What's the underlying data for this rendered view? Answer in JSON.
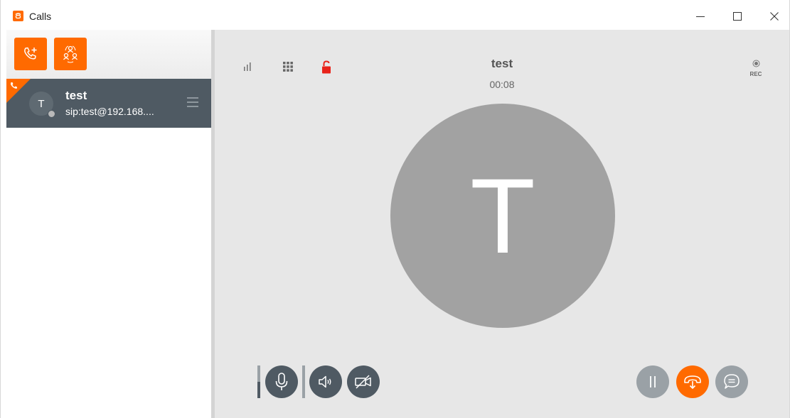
{
  "window": {
    "title": "Calls",
    "minimize_icon": "minimize-icon",
    "maximize_icon": "maximize-icon",
    "close_icon": "close-icon"
  },
  "sidebar": {
    "toolbar": {
      "new_call_icon": "phone-plus-icon",
      "conference_icon": "conference-icon"
    },
    "calls": [
      {
        "avatar_letter": "T",
        "name": "test",
        "address": "sip:test@192.168....",
        "status": "offline",
        "active": true
      }
    ]
  },
  "call": {
    "contact_name": "test",
    "duration": "00:08",
    "avatar_letter": "T",
    "rec_label": "REC",
    "mic_level": 0.5
  },
  "colors": {
    "accent": "#ff6a00",
    "dark": "#4f5a63",
    "avatar_gray": "#a2a2a2",
    "muted_button": "#9aa1a6",
    "background": "#e7e7e7",
    "lock_red": "#e8231a"
  }
}
